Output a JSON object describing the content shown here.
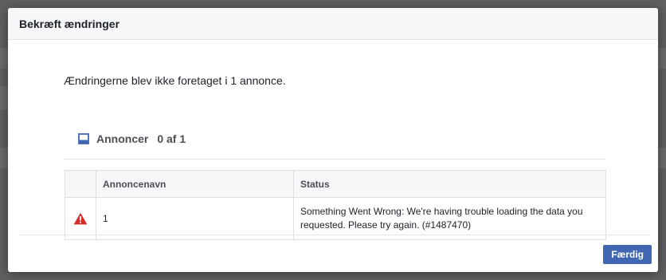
{
  "dialog": {
    "title": "Bekræft ændringer",
    "message": "Ændringerne blev ikke foretaget i 1 annonce.",
    "section": {
      "icon": "ad-layout-icon",
      "label": "Annoncer",
      "count": "0 af 1"
    },
    "table": {
      "headers": [
        "",
        "Annoncenavn",
        "Status"
      ],
      "rows": [
        {
          "icon": "warning-triangle-icon",
          "name": "1",
          "status": "Something Went Wrong: We're having trouble loading the data you requested. Please try again. (#1487470)"
        }
      ]
    },
    "done_label": "Færdig"
  },
  "colors": {
    "primary_button": "#4267b2",
    "warning": "#d62b2b",
    "icon_blue": "#4267b2"
  }
}
